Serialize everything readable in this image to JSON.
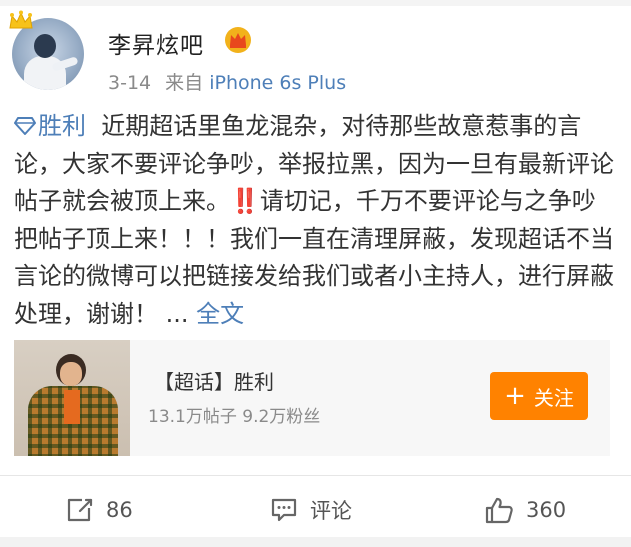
{
  "post": {
    "author": "李昇炫吧",
    "time": "3-14",
    "source_prefix": "来自",
    "device": "iPhone 6s Plus",
    "topic": "胜利",
    "text_1": "近期超话里鱼龙混杂，对待那些故意惹事的言论，大家不要评论争吵，举报拉黑，因为一旦有最新评论帖子就会被顶上来。",
    "alarm": "‼️",
    "text_2": "请切记，千万不要评论与之争吵把帖子顶上来！！！我们一直在清理屏蔽，发现超话不当言论的微博可以把链接发给我们或者小主持人，进行屏蔽处理，谢谢！",
    "ellipsis": "...",
    "full_text_label": "全文"
  },
  "card": {
    "title": "【超话】胜利",
    "stats": "13.1万帖子 9.2万粉丝",
    "follow_label": "关注",
    "follow_plus": "+"
  },
  "actions": {
    "repost_count": "86",
    "comment_label": "评论",
    "like_count": "360"
  },
  "colors": {
    "link": "#4e7fb8",
    "follow_button": "#ff8200",
    "vip_gold": "#f2b21b"
  },
  "icons": {
    "crown_badge": "crown-icon",
    "vip": "vip-crown-icon",
    "topic": "diamond-icon",
    "repost": "repost-icon",
    "comment": "comment-icon",
    "like": "thumbs-up-icon"
  }
}
